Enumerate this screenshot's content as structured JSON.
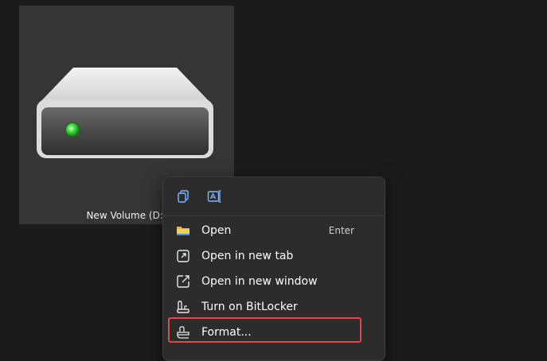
{
  "drive": {
    "label": "New Volume (D:)",
    "icon": "drive-icon",
    "led_color": "#3ddc3d"
  },
  "context_menu": {
    "quick_actions": [
      {
        "icon": "copy-icon",
        "label": "Copy"
      },
      {
        "icon": "rename-icon",
        "label": "Rename"
      }
    ],
    "items": [
      {
        "label": "Open",
        "shortcut": "Enter",
        "icon": "folder-icon"
      },
      {
        "label": "Open in new tab",
        "icon": "open-new-tab-icon"
      },
      {
        "label": "Open in new window",
        "icon": "open-new-window-icon"
      },
      {
        "label": "Turn on BitLocker",
        "icon": "bitlocker-key-icon"
      },
      {
        "label": "Format...",
        "icon": "format-icon"
      }
    ],
    "highlighted_item": "Format...",
    "highlight_color": "#e0474f"
  }
}
